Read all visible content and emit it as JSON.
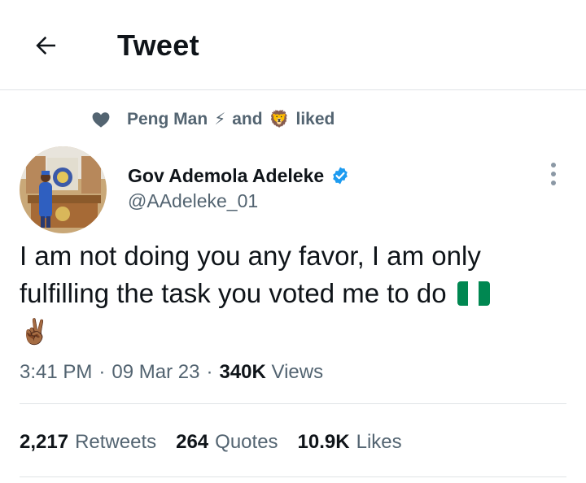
{
  "header": {
    "title": "Tweet",
    "back_icon": "arrow-left-icon"
  },
  "social_context": {
    "user1": "Peng Man",
    "emoji1": "⚡",
    "connector": "and",
    "emoji2": "🦁",
    "suffix": "liked",
    "icon": "heart-icon"
  },
  "author": {
    "name": "Gov Ademola Adeleke",
    "handle": "@AAdeleke_01",
    "verified_icon": "verified-badge-icon"
  },
  "tweet": {
    "line1": "I am not doing you any favor, I am only",
    "line2": "fulfilling the task you voted me to do",
    "emoji": "✌🏾"
  },
  "meta": {
    "time": "3:41 PM",
    "separator": "·",
    "date": "09 Mar 23",
    "views_count": "340K",
    "views_label": "Views"
  },
  "stats": {
    "retweets_count": "2,217",
    "retweets_label": "Retweets",
    "quotes_count": "264",
    "quotes_label": "Quotes",
    "likes_count": "10.9K",
    "likes_label": "Likes"
  },
  "colors": {
    "text_primary": "#0f1419",
    "text_secondary": "#536471",
    "verified_blue": "#1d9bf0",
    "divider": "#dfe3e6",
    "flag_green": "#008751"
  }
}
